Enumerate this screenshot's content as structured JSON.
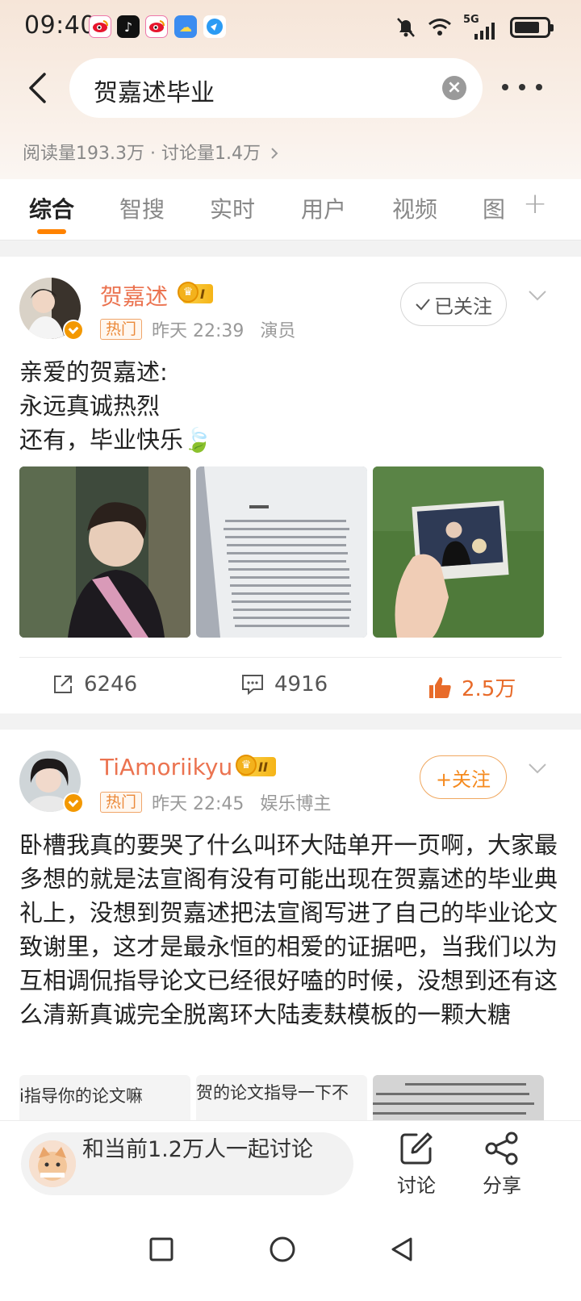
{
  "status_bar": {
    "time": "09:40",
    "network": "5G"
  },
  "search": {
    "query": "贺嘉述毕业",
    "stats": "阅读量193.3万 · 讨论量1.4万"
  },
  "tabs": [
    {
      "label": "综合",
      "active": true
    },
    {
      "label": "智搜"
    },
    {
      "label": "实时"
    },
    {
      "label": "用户"
    },
    {
      "label": "视频"
    },
    {
      "label": "图"
    }
  ],
  "posts": [
    {
      "username": "贺嘉述",
      "level": "I",
      "hot_tag": "热门",
      "time": "昨天 22:39",
      "role": "演员",
      "follow_label": "已关注",
      "text_lines": [
        "亲爱的贺嘉述:",
        "永远真诚热烈",
        "还有，毕业快乐🍃"
      ],
      "images": [
        "portrait-photo",
        "thesis-page-photo",
        "polaroid-photo"
      ],
      "repost_count": "6246",
      "comment_count": "4916",
      "like_count": "2.5万"
    },
    {
      "username": "TiAmoriikyu",
      "level": "II",
      "hot_tag": "热门",
      "time": "昨天 22:45",
      "role": "娱乐博主",
      "follow_label": "+关注",
      "text": "卧槽我真的要哭了什么叫环大陆单开一页啊，大家最多想的就是法宣阁有没有可能出现在贺嘉述的毕业典礼上，没想到贺嘉述把法宣阁写进了自己的毕业论文致谢里，这才是最永恒的相爱的证据吧，当我们以为互相调侃指导论文已经很好嗑的时候，没想到还有这么清新真诚完全脱离环大陆麦麸模板的一颗大糖",
      "image_captions": [
        "i指导你的论文嘛",
        "贺的论文指导一下不",
        ""
      ]
    }
  ],
  "bottom_bar": {
    "discuss_text": "和当前1.2万人一起讨论",
    "discuss_label": "讨论",
    "share_label": "分享"
  },
  "colors": {
    "accent": "#ff8200",
    "username": "#eb7350",
    "like": "#e86b2a"
  }
}
